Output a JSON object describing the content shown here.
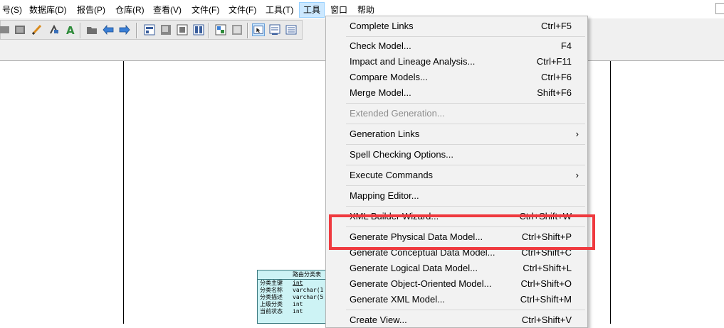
{
  "menubar": {
    "items": [
      {
        "label": "号(S)"
      },
      {
        "label": "数据库(D)"
      },
      {
        "label": "报告(P)"
      },
      {
        "label": "仓库(R)"
      },
      {
        "label": "查看(V)"
      },
      {
        "label": "文件(F)"
      },
      {
        "label": "文件(F)"
      },
      {
        "label": "工具(T)"
      },
      {
        "label": "工具"
      },
      {
        "label": "窗口"
      },
      {
        "label": "帮助"
      }
    ]
  },
  "dropdown": {
    "items": [
      {
        "label": "Complete Links",
        "shortcut": "Ctrl+F5"
      },
      {
        "label": "Check Model...",
        "shortcut": "F4"
      },
      {
        "label": "Impact and Lineage Analysis...",
        "shortcut": "Ctrl+F11"
      },
      {
        "label": "Compare Models...",
        "shortcut": "Ctrl+F6"
      },
      {
        "label": "Merge Model...",
        "shortcut": "Shift+F6"
      },
      {
        "label": "Extended Generation...",
        "shortcut": ""
      },
      {
        "label": "Generation Links",
        "shortcut": ""
      },
      {
        "label": "Spell Checking Options...",
        "shortcut": ""
      },
      {
        "label": "Execute Commands",
        "shortcut": ""
      },
      {
        "label": "Mapping Editor...",
        "shortcut": ""
      },
      {
        "label": "XML Builder Wizard...",
        "shortcut": "Ctrl+Shift+W"
      },
      {
        "label": "Generate Physical Data Model...",
        "shortcut": "Ctrl+Shift+P"
      },
      {
        "label": "Generate Conceptual Data Model...",
        "shortcut": "Ctrl+Shift+C"
      },
      {
        "label": "Generate Logical Data Model...",
        "shortcut": "Ctrl+Shift+L"
      },
      {
        "label": "Generate Object-Oriented Model...",
        "shortcut": "Ctrl+Shift+O"
      },
      {
        "label": "Generate XML Model...",
        "shortcut": "Ctrl+Shift+M"
      },
      {
        "label": "Create View...",
        "shortcut": "Ctrl+Shift+V"
      }
    ],
    "submenu_arrow": "›"
  },
  "entity": {
    "title": "路由分类表",
    "rows": [
      {
        "name": "分类主键",
        "type": "int"
      },
      {
        "name": "分类名称",
        "type": "varchar(1"
      },
      {
        "name": "分类描述",
        "type": "varchar(5"
      },
      {
        "name": "上级分类",
        "type": "int"
      },
      {
        "name": "当前状态",
        "type": "int"
      }
    ]
  },
  "colors": {
    "highlight_box": "#ef3a3f",
    "menu_background": "#f2f2f2",
    "entity_fill": "#cdf3f5",
    "active_menu": "#cce8ff"
  }
}
